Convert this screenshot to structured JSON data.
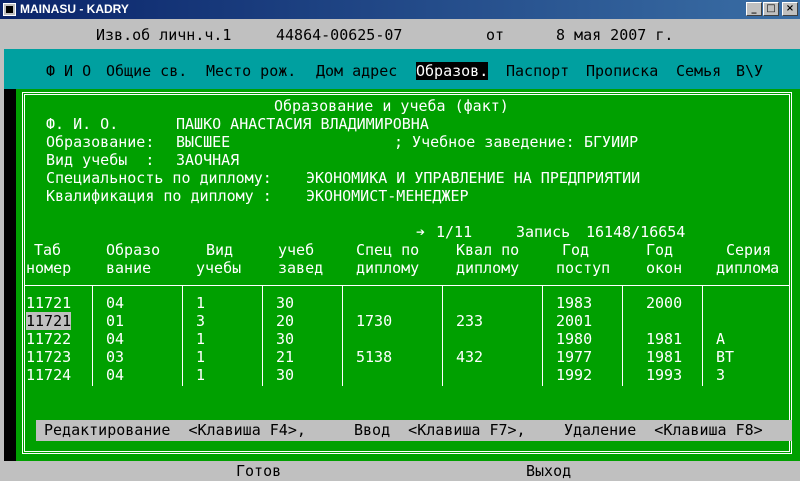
{
  "window": {
    "title": "MAINASU - KADRY",
    "minimize": "_",
    "maximize": "□",
    "close": "×"
  },
  "header": {
    "doc_label": "Изв.об личн.ч.1",
    "doc_number": "44864-00625-07",
    "from_label": "от",
    "date": "8 мая 2007 г."
  },
  "menu": {
    "items": [
      "Ф И О",
      "Общие св.",
      "Место рож.",
      "Дом адрес",
      "Образов.",
      "Паспорт",
      "Прописка",
      "Семья",
      "В\\У"
    ],
    "selected": "Образов."
  },
  "section": {
    "title": "Образование и учеба (факт)",
    "fio_label": "Ф. И. О.",
    "fio_value": "ПАШКО АНАСТАСИЯ ВЛАДИМИРОВНА",
    "education_label": "Образование:",
    "education_value": "ВЫСШЕЕ",
    "institution_label": "; Учебное заведение:",
    "institution_value": "БГУИИР",
    "study_type_label": "Вид учебы  :",
    "study_type_value": "ЗАОЧНАЯ",
    "specialty_label": "Специальность по диплому:",
    "specialty_value": "ЭКОНОМИКА И УПРАВЛЕНИЕ НА ПРЕДПРИЯТИИ",
    "qualification_label": "Квалификация по диплому :",
    "qualification_value": "ЭКОНОМИСТ-МЕНЕДЖЕР"
  },
  "pager": {
    "arrow": "➔",
    "page": "1/11",
    "record_label": "Запись",
    "record": "16148/16654"
  },
  "table": {
    "columns": [
      [
        "Таб",
        "номер"
      ],
      [
        "Образо",
        "вание"
      ],
      [
        "Вид",
        "учебы"
      ],
      [
        "учеб",
        "завед"
      ],
      [
        "Спец по",
        "диплому"
      ],
      [
        "Квал по",
        "диплому"
      ],
      [
        "Год",
        "поступ"
      ],
      [
        "Год",
        "окон"
      ],
      [
        "Серия",
        "диплома"
      ]
    ],
    "rows": [
      [
        "11721",
        "04",
        "1",
        "30",
        "",
        "",
        "1983",
        "2000",
        ""
      ],
      [
        "11721",
        "01",
        "3",
        "20",
        "1730",
        "233",
        "2001",
        "",
        ""
      ],
      [
        "11722",
        "04",
        "1",
        "30",
        "",
        "",
        "1980",
        "1981",
        "А"
      ],
      [
        "11723",
        "03",
        "1",
        "21",
        "5138",
        "432",
        "1977",
        "1981",
        "ВТ"
      ],
      [
        "11724",
        "04",
        "1",
        "30",
        "",
        "",
        "1992",
        "1993",
        "З"
      ]
    ]
  },
  "commands": {
    "edit": "Редактирование  <Клавиша F4>,",
    "input": "Ввод  <Клавиша F7>,",
    "delete": "Удаление  <Клавиша F8>"
  },
  "status": {
    "ready": "Готов",
    "exit": "Выход"
  }
}
